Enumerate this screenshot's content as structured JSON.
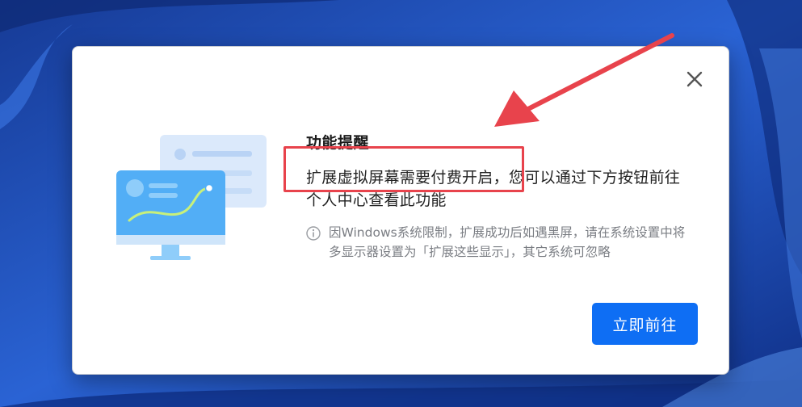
{
  "dialog": {
    "title": "功能提醒",
    "message": "扩展虚拟屏幕需要付费开启，您可以通过下方按钮前往个人中心查看此功能",
    "note": "因Windows系统限制，扩展成功后如遇黑屏，请在系统设置中将多显示器设置为「扩展这些显示」，其它系统可忽略",
    "primary_button": "立即前往",
    "icons": {
      "close": "close-icon",
      "info": "info-icon",
      "illustration": "monitor-illustration"
    }
  },
  "colors": {
    "accent": "#0e6ef4",
    "annotation": "#e8434c",
    "wallpaper": "#1f4fb8"
  }
}
